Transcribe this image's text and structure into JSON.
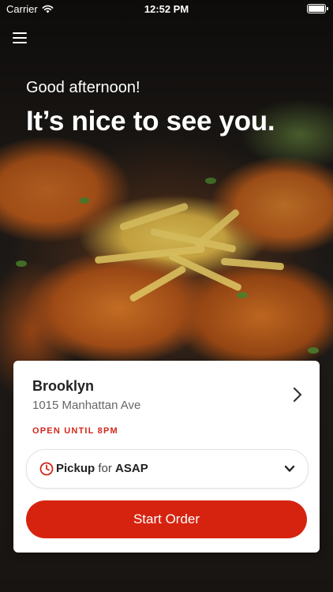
{
  "status_bar": {
    "carrier": "Carrier",
    "time": "12:52 PM",
    "icons": [
      "wifi-icon",
      "battery-icon"
    ]
  },
  "header": {
    "menu_icon": "hamburger-menu-icon",
    "greeting": "Good afternoon!",
    "headline": "It’s nice to see you."
  },
  "location_card": {
    "name": "Brooklyn",
    "address": "1015 Manhattan Ave",
    "hours": "OPEN UNTIL 8PM",
    "pickup": {
      "icon": "clock-icon",
      "mode": "Pickup",
      "connector": "for",
      "time": "ASAP"
    },
    "start_button": "Start Order"
  },
  "colors": {
    "accent": "#d6230f",
    "hours_text": "#d0281d",
    "card_bg": "#ffffff"
  }
}
